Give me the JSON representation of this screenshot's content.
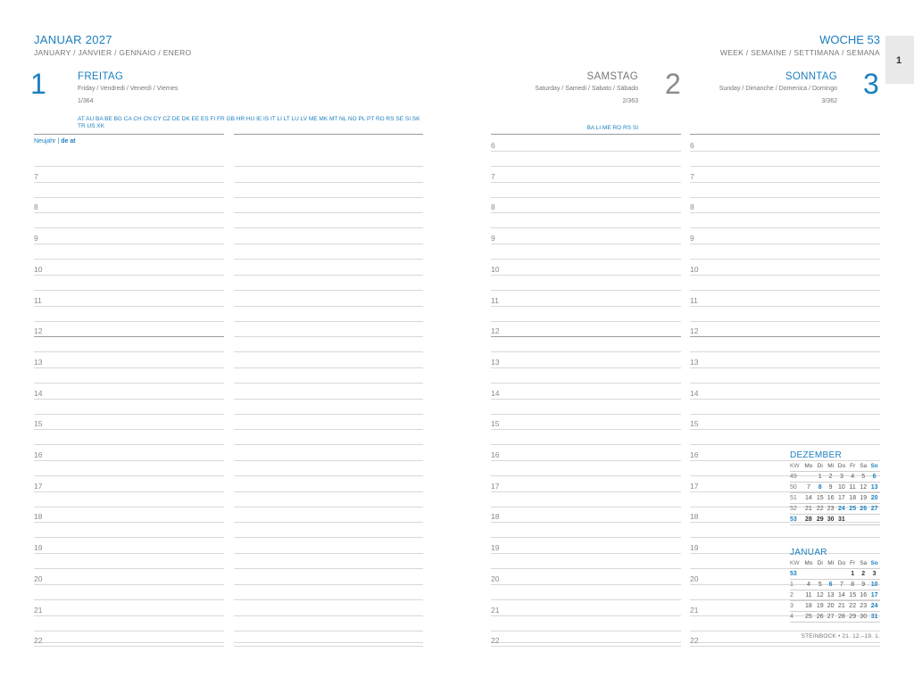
{
  "header": {
    "month_title": "JANUAR 2027",
    "month_sub": "JANUARY / JANVIER / GENNAIO / ENERO",
    "week_title": "WOCHE 53",
    "week_sub": "WEEK / SEMAINE / SETTIMANA / SEMANA",
    "tab": "1"
  },
  "days": [
    {
      "number": "1",
      "name": "FREITAG",
      "sub": "Friday / Vendredi / Venerdì / Viernes",
      "index": "1/364",
      "countries": "AT AU BA BE BG CA CH CN CY CZ DE DK EE ES FI FR GB HR HU IE IS IT LI LT LU LV ME MK MT NL NO PL PT RO RS SE SI SK TR US XK"
    },
    {
      "number": "2",
      "name": "SAMSTAG",
      "sub": "Saturday / Samedi / Sabato / Sábado",
      "index": "2/363",
      "countries": "BA LI ME RO RS SI"
    },
    {
      "number": "3",
      "name": "SONNTAG",
      "sub": "Sunday / Dimanche / Domenica / Domingo",
      "index": "3/362",
      "countries": ""
    }
  ],
  "holiday": {
    "name": "Neujahr",
    "sep": "|",
    "regions": "de  at"
  },
  "hours": [
    "6",
    "7",
    "8",
    "9",
    "10",
    "11",
    "12",
    "13",
    "14",
    "15",
    "16",
    "17",
    "18",
    "19",
    "20",
    "21",
    "22"
  ],
  "mini_calendars": [
    {
      "name": "DEZEMBER",
      "header": [
        "KW",
        "Mo",
        "Di",
        "Mi",
        "Do",
        "Fr",
        "Sa",
        "So"
      ],
      "rows": [
        [
          "49",
          "",
          "1",
          "2",
          "3",
          "4",
          "5",
          "6"
        ],
        [
          "50",
          "7",
          "8",
          "9",
          "10",
          "11",
          "12",
          "13"
        ],
        [
          "51",
          "14",
          "15",
          "16",
          "17",
          "18",
          "19",
          "20"
        ],
        [
          "52",
          "21",
          "22",
          "23",
          "24",
          "25",
          "26",
          "27"
        ],
        [
          "53",
          "28",
          "29",
          "30",
          "31",
          "",
          "",
          ""
        ]
      ]
    },
    {
      "name": "JANUAR",
      "header": [
        "KW",
        "Mo",
        "Di",
        "Mi",
        "Do",
        "Fr",
        "Sa",
        "So"
      ],
      "rows": [
        [
          "53",
          "",
          "",
          "",
          "",
          "1",
          "2",
          "3"
        ],
        [
          "1",
          "4",
          "5",
          "6",
          "7",
          "8",
          "9",
          "10"
        ],
        [
          "2",
          "11",
          "12",
          "13",
          "14",
          "15",
          "16",
          "17"
        ],
        [
          "3",
          "18",
          "19",
          "20",
          "21",
          "22",
          "23",
          "24"
        ],
        [
          "4",
          "25",
          "26",
          "27",
          "28",
          "29",
          "30",
          "31"
        ]
      ]
    }
  ],
  "zodiac": "STEINBOCK • 21. 12.–19. 1.",
  "colors": {
    "accent": "#1b7fc0",
    "text": "#555555",
    "rule": "#d8d8d8"
  }
}
